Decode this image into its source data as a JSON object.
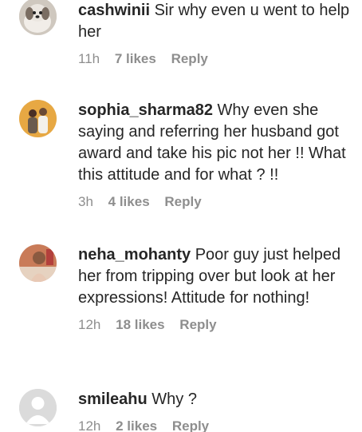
{
  "comments": [
    {
      "username": "cashwinii",
      "text": "Sir why even u went to help her",
      "time": "11h",
      "likes": "7 likes",
      "reply": "Reply",
      "avatar_icon": "dog-avatar-icon"
    },
    {
      "username": "sophia_sharma82",
      "text": "Why even she saying and referring her husband got award and take his pic not her !! What this attitude and for what ? !!",
      "time": "3h",
      "likes": "4 likes",
      "reply": "Reply",
      "avatar_icon": "couple-avatar-icon"
    },
    {
      "username": "neha_mohanty",
      "text": "Poor guy just helped her from tripping over but look at her expressions! Attitude for nothing!",
      "time": "12h",
      "likes": "18 likes",
      "reply": "Reply",
      "avatar_icon": "woman-avatar-icon"
    },
    {
      "username": "smileahu",
      "text": "Why ?",
      "time": "12h",
      "likes": "2 likes",
      "reply": "Reply",
      "avatar_icon": "default-avatar-icon"
    }
  ],
  "colors": {
    "text": "#262626",
    "secondary": "#8e8e8e",
    "avatar_placeholder": "#dbdbdb"
  }
}
